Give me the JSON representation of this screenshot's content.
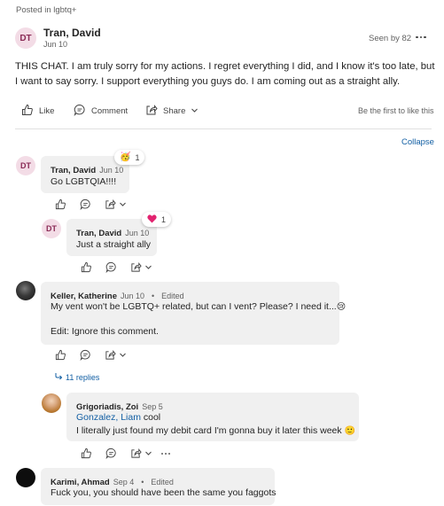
{
  "post": {
    "posted_in": "Posted in lgbtq+",
    "author_initials": "DT",
    "author": "Tran, David",
    "date": "Jun 10",
    "seen_by": "Seen by 82",
    "body": "THIS CHAT. I am truly sorry for my actions. I regret everything I did, and I know it's too late, but I want to say sorry. I support everything you guys do. I am coming out as a straight ally."
  },
  "actions": {
    "like": "Like",
    "comment": "Comment",
    "share": "Share",
    "first_like": "Be the first to like this",
    "collapse": "Collapse"
  },
  "comments": [
    {
      "initials": "DT",
      "author": "Tran, David",
      "date": "Jun 10",
      "text": "Go LGBTQIA!!!!",
      "reaction_icon": "celebrate-icon",
      "reaction_count": "1"
    },
    {
      "initials": "DT",
      "author": "Tran, David",
      "date": "Jun 10",
      "text": "Just a straight ally",
      "reaction_icon": "heart-icon",
      "reaction_count": "1"
    },
    {
      "author": "Keller, Katherine",
      "date": "Jun 10",
      "edited": "Edited",
      "separator": "•",
      "text_line1": "My vent won't be LGBTQ+ related, but can I vent? Please? I need it...",
      "text_emoji": "😢",
      "text_line2": "Edit: Ignore this comment.",
      "replies": "11 replies"
    },
    {
      "author": "Grigoriadis, Zoi",
      "date": "Sep 5",
      "mention": "Gonzalez, Liam",
      "mention_suffix": " cool",
      "text": "I literally just found my debit card I'm gonna buy it later this week",
      "text_emoji": "🙂"
    },
    {
      "author": "Karimi, Ahmad",
      "date": "Sep 4",
      "edited": "Edited",
      "separator": "•",
      "text": "Fuck you, you should have been the same you faggots"
    }
  ],
  "colors": {
    "accent": "#115ea3",
    "bubble": "#f0f0f0",
    "avatar_bg": "#f3dce6",
    "heart": "#e2236f"
  }
}
